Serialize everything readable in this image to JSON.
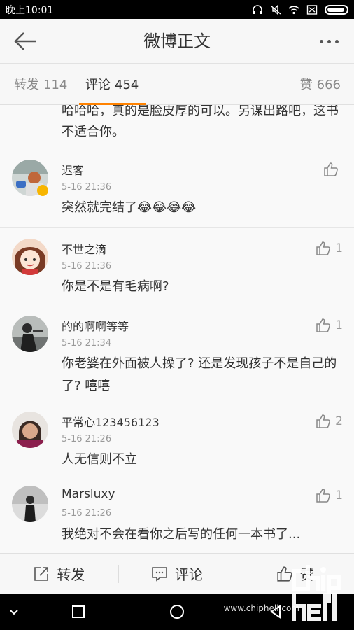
{
  "status_bar": {
    "time": "晚上10:01"
  },
  "header": {
    "title": "微博正文"
  },
  "tabs": [
    {
      "label": "转发",
      "count": "114"
    },
    {
      "label": "评论",
      "count": "454"
    },
    {
      "label": "赞",
      "count": "666"
    }
  ],
  "partial_comment": {
    "text": "哈哈哈，真的是脸皮厚的可以。另谋出路吧，这书不适合你。"
  },
  "comments": [
    {
      "user": "迟客",
      "time": "5-16 21:36",
      "text": "突然就完结了😂😂😂😂",
      "likes": ""
    },
    {
      "user": "不世之滴",
      "time": "5-16 21:36",
      "text": "你是不是有毛病啊?",
      "likes": "1"
    },
    {
      "user": "的的啊啊等等",
      "time": "5-16 21:34",
      "text": "你老婆在外面被人操了? 还是发现孩子不是自己的了? 嘻嘻",
      "likes": "1"
    },
    {
      "user": "平常心123456123",
      "time": "5-16 21:26",
      "text": "人无信则不立",
      "likes": "2"
    },
    {
      "user": "Marsluxy",
      "time": "5-16 21:26",
      "text": "我绝对不会在看你之后写的任何一本书了...",
      "likes": "1"
    }
  ],
  "actions": {
    "repost": "转发",
    "comment": "评论",
    "like": "赞"
  },
  "watermark": "www.chiphell.com",
  "logo_text": "chip hell",
  "colors": {
    "accent": "#ff8200",
    "text": "#333333",
    "muted": "#999999"
  }
}
